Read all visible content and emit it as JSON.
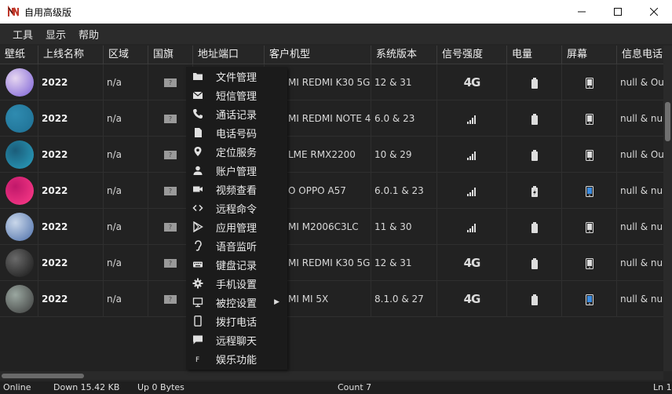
{
  "window": {
    "title": "自用高级版"
  },
  "menu": [
    "工具",
    "显示",
    "帮助"
  ],
  "columns": [
    "壁纸",
    "上线名称",
    "区域",
    "国旗",
    "地址端口",
    "客户机型",
    "系统版本",
    "信号强度",
    "电量",
    "屏幕",
    "信息电话"
  ],
  "rows": [
    {
      "name": "2022",
      "region": "n/a",
      "model": "XIAOMI REDMI K30 5G",
      "model_visible": "MI REDMI K30 5G",
      "version": "12 & 31",
      "signal": "4G",
      "battery": "full",
      "screen": "on",
      "info": "null & Out",
      "wallpaper": [
        "#7a5fd6",
        "#e6d6f0"
      ]
    },
    {
      "name": "2022",
      "region": "n/a",
      "model_visible": "MI REDMI NOTE 4X",
      "version": "6.0 & 23",
      "signal": "bars",
      "battery": "full",
      "screen": "on",
      "info": "null & null",
      "wallpaper": [
        "#1e6f93",
        "#2f8bb0"
      ]
    },
    {
      "name": "2022",
      "region": "n/a",
      "model_visible": "LME RMX2200",
      "version": "10 & 29",
      "signal": "bars",
      "battery": "full",
      "screen": "on",
      "info": "null & Out",
      "wallpaper": [
        "#2aa0c0",
        "#1b5d7a"
      ]
    },
    {
      "name": "2022",
      "region": "n/a",
      "model_visible": "O OPPO A57",
      "version": "6.0.1 & 23",
      "signal": "bars",
      "battery": "charging",
      "screen": "blue",
      "info": "null & null",
      "wallpaper": [
        "#ff3c8a",
        "#c0186a"
      ]
    },
    {
      "name": "2022",
      "region": "n/a",
      "model_visible": "MI M2006C3LC",
      "version": "11 & 30",
      "signal": "bars",
      "battery": "full",
      "screen": "on",
      "info": "null & null",
      "wallpaper": [
        "#4a6da8",
        "#c9d7ea"
      ]
    },
    {
      "name": "2022",
      "region": "n/a",
      "model_visible": "MI REDMI K30 5G",
      "version": "12 & 31",
      "signal": "4G",
      "battery": "full",
      "screen": "on",
      "info": "null & null",
      "wallpaper": [
        "#151515",
        "#6a6a6a"
      ]
    },
    {
      "name": "2022",
      "region": "n/a",
      "model_visible": "MI MI 5X",
      "version": "8.1.0 & 27",
      "signal": "4G",
      "battery": "full",
      "screen": "blue",
      "info": "null & null",
      "wallpaper": [
        "#3a3a3a",
        "#9aa7a0"
      ]
    }
  ],
  "flag_placeholder": "?",
  "context_menu": [
    {
      "label": "文件管理",
      "icon": "folder-icon"
    },
    {
      "label": "短信管理",
      "icon": "mail-icon"
    },
    {
      "label": "通话记录",
      "icon": "phone-icon"
    },
    {
      "label": "电话号码",
      "icon": "sim-card-icon"
    },
    {
      "label": "定位服务",
      "icon": "location-pin-icon"
    },
    {
      "label": "账户管理",
      "icon": "account-icon"
    },
    {
      "label": "视频查看",
      "icon": "video-camera-icon"
    },
    {
      "label": "远程命令",
      "icon": "code-icon"
    },
    {
      "label": "应用管理",
      "icon": "play-app-icon"
    },
    {
      "label": "语音监听",
      "icon": "ear-icon"
    },
    {
      "label": "键盘记录",
      "icon": "keyboard-icon"
    },
    {
      "label": "手机设置",
      "icon": "gear-icon"
    },
    {
      "label": "被控设置",
      "icon": "monitor-icon",
      "submenu": true
    },
    {
      "label": "拨打电话",
      "icon": "smartphone-icon"
    },
    {
      "label": "远程聊天",
      "icon": "chat-bubble-icon"
    },
    {
      "label": "娱乐功能",
      "icon": "font-f-icon"
    }
  ],
  "status": {
    "online": "Online",
    "down": "Down 15.42 KB",
    "up": "Up 0 Bytes",
    "count": "Count 7",
    "line": "Ln 1"
  }
}
